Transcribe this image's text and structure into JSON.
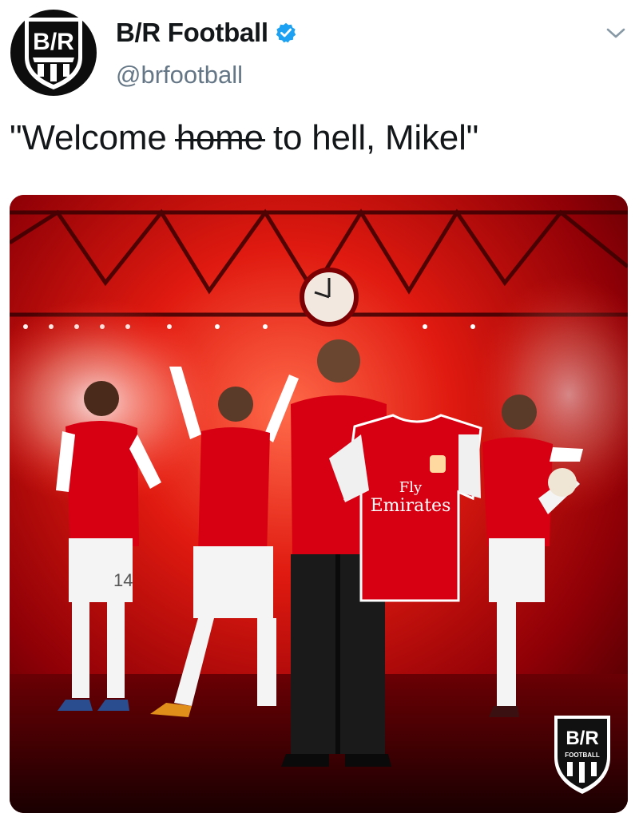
{
  "account": {
    "display_name": "B/R Football",
    "handle": "@brfootball",
    "avatar_text": "B/R",
    "verified": true
  },
  "tweet": {
    "text_before": "\"Welcome ",
    "struck_word": "home",
    "text_after": " to hell, Mikel\""
  },
  "media": {
    "jersey_sponsor_line1": "Fly",
    "jersey_sponsor_line2": "Emirates",
    "player_number": "14",
    "watermark_top": "B/R",
    "watermark_bottom": "FOOTBALL"
  },
  "icons": {
    "verified": "verified-badge-icon",
    "menu": "chevron-down-icon"
  },
  "colors": {
    "verified_blue": "#1da1f2",
    "text_primary": "#14171a",
    "text_secondary": "#657786",
    "arsenal_red": "#d60012"
  }
}
